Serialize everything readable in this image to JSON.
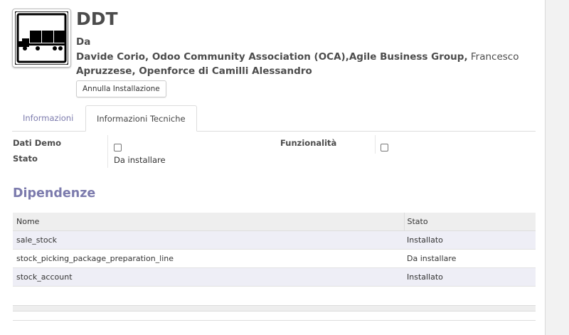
{
  "module": {
    "icon": "truck-icon",
    "title": "DDT",
    "author_label": "Da",
    "authors_bold": "Davide Corio, Odoo Community Association (OCA),Agile Business Group,",
    "authors_plain": " Francesco",
    "authors_line2": "Apruzzese, Openforce di Camilli Alessandro",
    "uninstall_button": "Annulla Installazione"
  },
  "tabs": [
    {
      "label": "Informazioni",
      "active": false
    },
    {
      "label": "Informazioni Tecniche",
      "active": true
    }
  ],
  "fields": {
    "demo_label": "Dati Demo",
    "demo_checked": false,
    "features_label": "Funzionalità",
    "features_checked": false,
    "state_label": "Stato",
    "state_value": "Da installare"
  },
  "dependencies": {
    "title": "Dipendenze",
    "columns": [
      "Nome",
      "Stato"
    ],
    "rows": [
      {
        "name": "sale_stock",
        "state": "Installato"
      },
      {
        "name": "stock_picking_package_preparation_line",
        "state": "Da installare"
      },
      {
        "name": "stock_account",
        "state": "Installato"
      }
    ]
  },
  "colors": {
    "accent": "#7c7bad",
    "text": "#4c4c4c",
    "row_alt": "#eeeef6"
  }
}
